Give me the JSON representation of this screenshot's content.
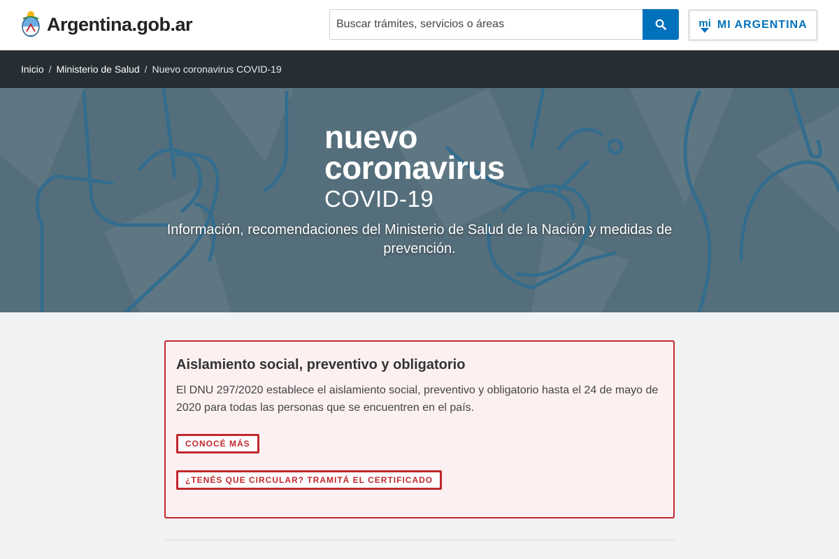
{
  "header": {
    "logo_text": "Argentina.gob.ar",
    "search_placeholder": "Buscar trámites, servicios o áreas",
    "mi_badge": "mi",
    "mi_argentina_label": "MI ARGENTINA"
  },
  "breadcrumb": {
    "items": [
      "Inicio",
      "Ministerio de Salud"
    ],
    "current": "Nuevo coronavirus COVID-19",
    "separator": "/"
  },
  "hero": {
    "title_line1": "nuevo",
    "title_line2": "coronavirus",
    "title_line3": "COVID-19",
    "subtitle": "Información, recomendaciones del Ministerio de Salud de la Nación y medidas de prevención."
  },
  "alert": {
    "title": "Aislamiento social, preventivo y obligatorio",
    "body": "El DNU 297/2020 establece el aislamiento social, preventivo y obligatorio hasta el 24 de mayo de 2020 para todas las personas que se encuentren en el país.",
    "button_more": "CONOCÉ MÁS",
    "button_certificate": "¿TENÉS QUE CIRCULAR? TRAMITÁ EL CERTIFICADO"
  },
  "colors": {
    "primary_blue": "#0072bb",
    "alert_red": "#c0282d",
    "alert_bg": "#fcf0f1",
    "page_bg": "#f1f2f4"
  },
  "icons": {
    "search": "search-icon",
    "mi_argentina": "mi-argentina-icon",
    "logo": "argentina-shield-icon"
  }
}
